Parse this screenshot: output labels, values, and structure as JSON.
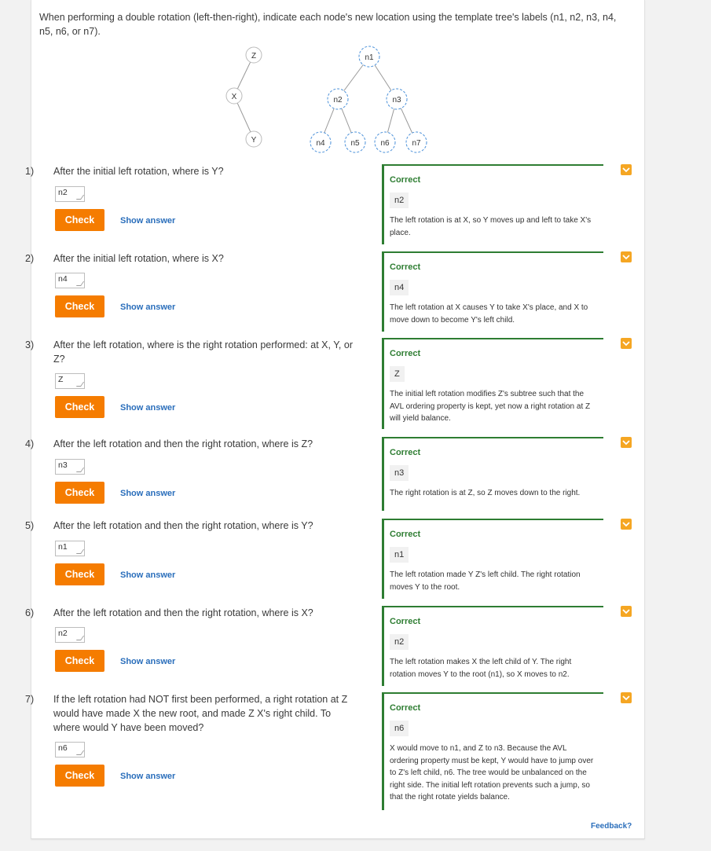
{
  "intro": "When performing a double rotation (left-then-right), indicate each node's new location using the template tree's labels (n1, n2, n3, n4, n5, n6, or n7).",
  "tree_left": {
    "z": "Z",
    "x": "X",
    "y": "Y"
  },
  "tree_right": {
    "n1": "n1",
    "n2": "n2",
    "n3": "n3",
    "n4": "n4",
    "n5": "n5",
    "n6": "n6",
    "n7": "n7"
  },
  "check_label": "Check",
  "show_answer_label": "Show answer",
  "questions": [
    {
      "num": "1)",
      "text": "After the initial left rotation, where is Y?",
      "value": "n2",
      "status": "Correct",
      "answer": "n2",
      "explanation": "The left rotation is at X, so Y moves up and left to take X's place."
    },
    {
      "num": "2)",
      "text": "After the initial left rotation, where is X?",
      "value": "n4",
      "status": "Correct",
      "answer": "n4",
      "explanation": "The left rotation at X causes Y to take X's place, and X to move down to become Y's left child."
    },
    {
      "num": "3)",
      "text": "After the left rotation, where is the right rotation performed: at X, Y, or Z?",
      "value": "Z",
      "status": "Correct",
      "answer": "Z",
      "explanation": "The initial left rotation modifies Z's subtree such that the AVL ordering property is kept, yet now a right rotation at Z will yield balance."
    },
    {
      "num": "4)",
      "text": "After the left rotation and then the right rotation, where is Z?",
      "value": "n3",
      "status": "Correct",
      "answer": "n3",
      "explanation": "The right rotation is at Z, so Z moves down to the right."
    },
    {
      "num": "5)",
      "text": "After the left rotation and then the right rotation, where is Y?",
      "value": "n1",
      "status": "Correct",
      "answer": "n1",
      "explanation": "The left rotation made Y Z's left child. The right rotation moves Y to the root."
    },
    {
      "num": "6)",
      "text": "After the left rotation and then the right rotation, where is X?",
      "value": "n2",
      "status": "Correct",
      "answer": "n2",
      "explanation": "The left rotation makes X the left child of Y. The right rotation moves Y to the root (n1), so X moves to n2."
    },
    {
      "num": "7)",
      "text": "If the left rotation had NOT first been performed, a right rotation at Z would have made X the new root, and made Z X's right child. To where would Y have been moved?",
      "value": "n6",
      "status": "Correct",
      "answer": "n6",
      "explanation": "X would move to n1, and Z to n3. Because the AVL ordering property must be kept, Y would have to jump over to Z's left child, n6. The tree would be unbalanced on the right side. The initial left rotation prevents such a jump, so that the right rotate yields balance."
    }
  ],
  "feedback_link": "Feedback?",
  "colors": {
    "accent": "#f57c00",
    "correct": "#2e7d32",
    "link": "#2a6ebb",
    "chevron": "#f5a623"
  }
}
